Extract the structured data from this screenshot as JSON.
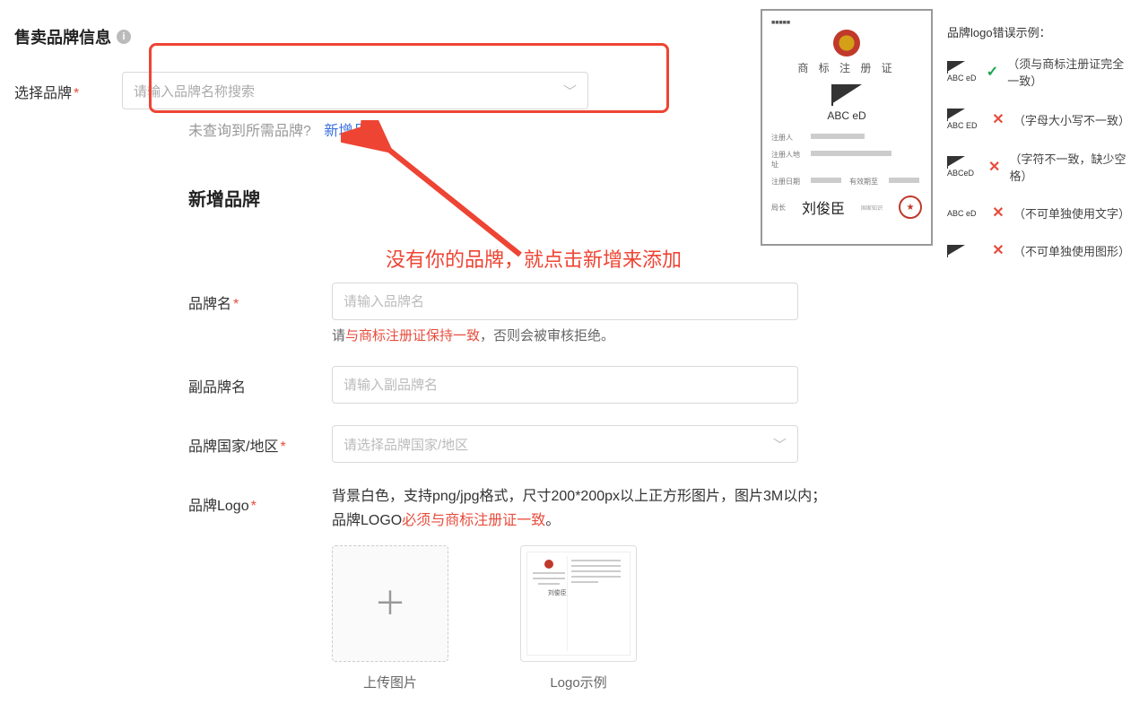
{
  "section_title": "售卖品牌信息",
  "brand_search": {
    "label": "选择品牌",
    "placeholder": "请输入品牌名称搜索"
  },
  "not_found": {
    "text": "未查询到所需品牌?",
    "link": "新增品牌"
  },
  "annotation": "没有你的品牌，就点击新增来添加",
  "panel": {
    "title": "新增品牌",
    "brand_name": {
      "label": "品牌名",
      "placeholder": "请输入品牌名",
      "hint_prefix": "请",
      "hint_red": "与商标注册证保持一致",
      "hint_suffix": "，否则会被审核拒绝。"
    },
    "sub_brand": {
      "label": "副品牌名",
      "placeholder": "请输入副品牌名"
    },
    "region": {
      "label": "品牌国家/地区",
      "placeholder": "请选择品牌国家/地区"
    },
    "logo": {
      "label": "品牌Logo",
      "hint_line1": "背景白色，支持png/jpg格式，尺寸200*200px以上正方形图片，图片3M以内；",
      "hint_line2_prefix": "品牌LOGO",
      "hint_line2_red": "必须与商标注册证一致",
      "hint_line2_suffix": "。",
      "upload_caption": "上传图片",
      "example_caption": "Logo示例"
    }
  },
  "certificate": {
    "title": "商 标 注 册 证",
    "brand_text": "ABC eD",
    "fields": {
      "f1": "注册人",
      "f2": "注册人地址",
      "f3": "注册日期",
      "f4": "有效期至",
      "f5": "局长"
    },
    "signature": "刘俊臣"
  },
  "legend": {
    "title": "品牌logo错误示例：",
    "rows": [
      {
        "sample_label": "ABC eD",
        "mark": "ok",
        "text": "（须与商标注册证完全一致）",
        "shape": true
      },
      {
        "sample_label": "ABC ED",
        "mark": "no",
        "text": "（字母大小写不一致）",
        "shape": true
      },
      {
        "sample_label": "ABCeD",
        "mark": "no",
        "text": "（字符不一致，缺少空格）",
        "shape": true
      },
      {
        "sample_label": "ABC eD",
        "mark": "no",
        "text": "（不可单独使用文字）",
        "shape": false
      },
      {
        "sample_label": "",
        "mark": "no",
        "text": "（不可单独使用图形）",
        "shape": true
      }
    ]
  }
}
